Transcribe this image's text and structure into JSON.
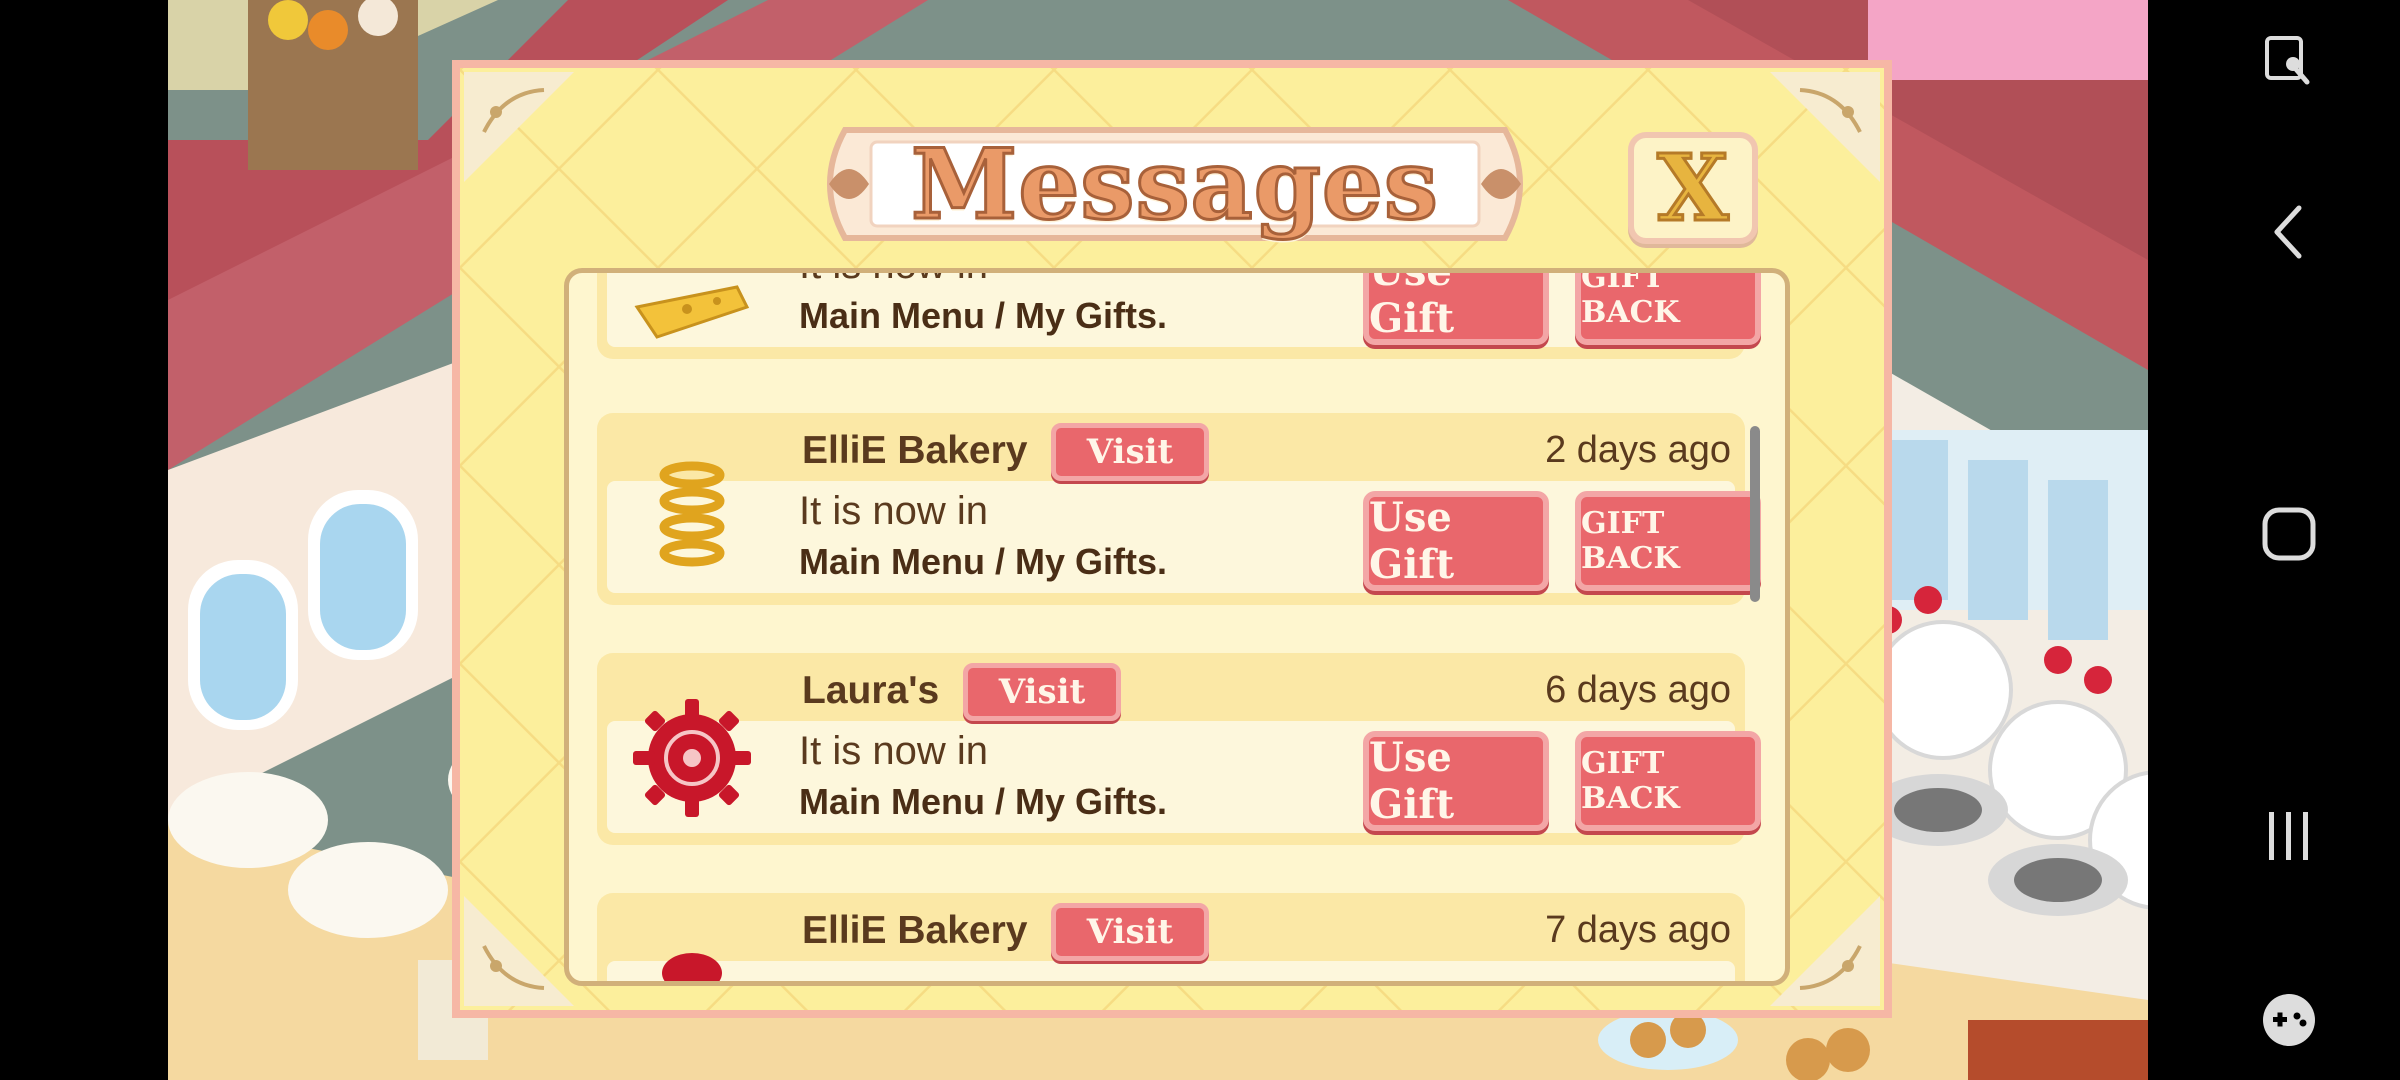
{
  "dialog": {
    "title": "Messages",
    "close_label": "X"
  },
  "messages": [
    {
      "sender": "",
      "time": "",
      "line1": "It is now in",
      "line2": "Main Menu / My Gifts.",
      "use_gift_label": "Use Gift",
      "gift_back_label": "GIFT BACK",
      "icon": "cheese-icon"
    },
    {
      "sender": "ElliE Bakery",
      "visit_label": "Visit",
      "time": "2 days ago",
      "line1": "It is now in",
      "line2": "Main Menu / My Gifts.",
      "use_gift_label": "Use Gift",
      "gift_back_label": "GIFT BACK",
      "icon": "spring-icon"
    },
    {
      "sender": "Laura's",
      "visit_label": "Visit",
      "time": "6 days ago",
      "line1": "It is now in",
      "line2": "Main Menu / My Gifts.",
      "use_gift_label": "Use Gift",
      "gift_back_label": "GIFT BACK",
      "icon": "red-gear-icon"
    },
    {
      "sender": "ElliE Bakery",
      "visit_label": "Visit",
      "time": "7 days ago",
      "icon": "red-item-icon"
    }
  ],
  "system_nav": {
    "icons": [
      "screenshot-edit-icon",
      "back-icon",
      "home-icon",
      "recents-icon",
      "game-controller-icon"
    ]
  },
  "colors": {
    "button_red": "#e9676c",
    "dialog_yellow": "#fcef9c",
    "panel_cream": "#fef6cf",
    "text_brown": "#5a3a1e"
  }
}
